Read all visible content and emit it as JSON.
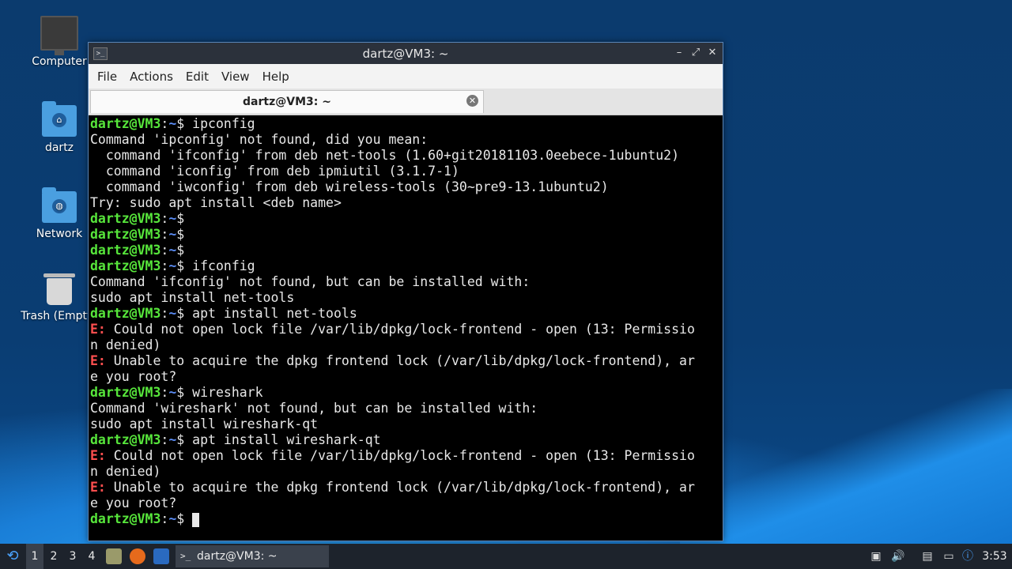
{
  "desktop": {
    "icons": [
      {
        "label": "Computer"
      },
      {
        "label": "dartz"
      },
      {
        "label": "Network"
      },
      {
        "label": "Trash (Empty)"
      }
    ]
  },
  "window": {
    "title": "dartz@VM3: ~",
    "menu": [
      "File",
      "Actions",
      "Edit",
      "View",
      "Help"
    ],
    "tab_label": "dartz@VM3: ~"
  },
  "terminal": {
    "user": "dartz@VM3",
    "path": "~",
    "lines": [
      {
        "kind": "prompt",
        "cmd": "ipconfig"
      },
      {
        "kind": "out",
        "text": "Command 'ipconfig' not found, did you mean:"
      },
      {
        "kind": "out",
        "text": "  command 'ifconfig' from deb net-tools (1.60+git20181103.0eebece-1ubuntu2)"
      },
      {
        "kind": "out",
        "text": "  command 'iconfig' from deb ipmiutil (3.1.7-1)"
      },
      {
        "kind": "out",
        "text": "  command 'iwconfig' from deb wireless-tools (30~pre9-13.1ubuntu2)"
      },
      {
        "kind": "out",
        "text": "Try: sudo apt install <deb name>"
      },
      {
        "kind": "prompt",
        "cmd": ""
      },
      {
        "kind": "prompt",
        "cmd": ""
      },
      {
        "kind": "prompt",
        "cmd": ""
      },
      {
        "kind": "prompt",
        "cmd": "ifconfig"
      },
      {
        "kind": "out",
        "text": "Command 'ifconfig' not found, but can be installed with:"
      },
      {
        "kind": "out",
        "text": "sudo apt install net-tools"
      },
      {
        "kind": "prompt",
        "cmd": "apt install net-tools"
      },
      {
        "kind": "err",
        "text": " Could not open lock file /var/lib/dpkg/lock-frontend - open (13: Permissio"
      },
      {
        "kind": "out",
        "text": "n denied)"
      },
      {
        "kind": "err",
        "text": " Unable to acquire the dpkg frontend lock (/var/lib/dpkg/lock-frontend), ar"
      },
      {
        "kind": "out",
        "text": "e you root?"
      },
      {
        "kind": "prompt",
        "cmd": "wireshark"
      },
      {
        "kind": "out",
        "text": "Command 'wireshark' not found, but can be installed with:"
      },
      {
        "kind": "out",
        "text": "sudo apt install wireshark-qt"
      },
      {
        "kind": "prompt",
        "cmd": "apt install wireshark-qt"
      },
      {
        "kind": "err",
        "text": " Could not open lock file /var/lib/dpkg/lock-frontend - open (13: Permissio"
      },
      {
        "kind": "out",
        "text": "n denied)"
      },
      {
        "kind": "err",
        "text": " Unable to acquire the dpkg frontend lock (/var/lib/dpkg/lock-frontend), ar"
      },
      {
        "kind": "out",
        "text": "e you root?"
      },
      {
        "kind": "prompt",
        "cmd": "",
        "cursor": true
      }
    ],
    "error_prefix": "E:"
  },
  "taskbar": {
    "workspaces": [
      "1",
      "2",
      "3",
      "4"
    ],
    "active_workspace": "1",
    "task_label": "dartz@VM3: ~",
    "clock": "3:53"
  }
}
